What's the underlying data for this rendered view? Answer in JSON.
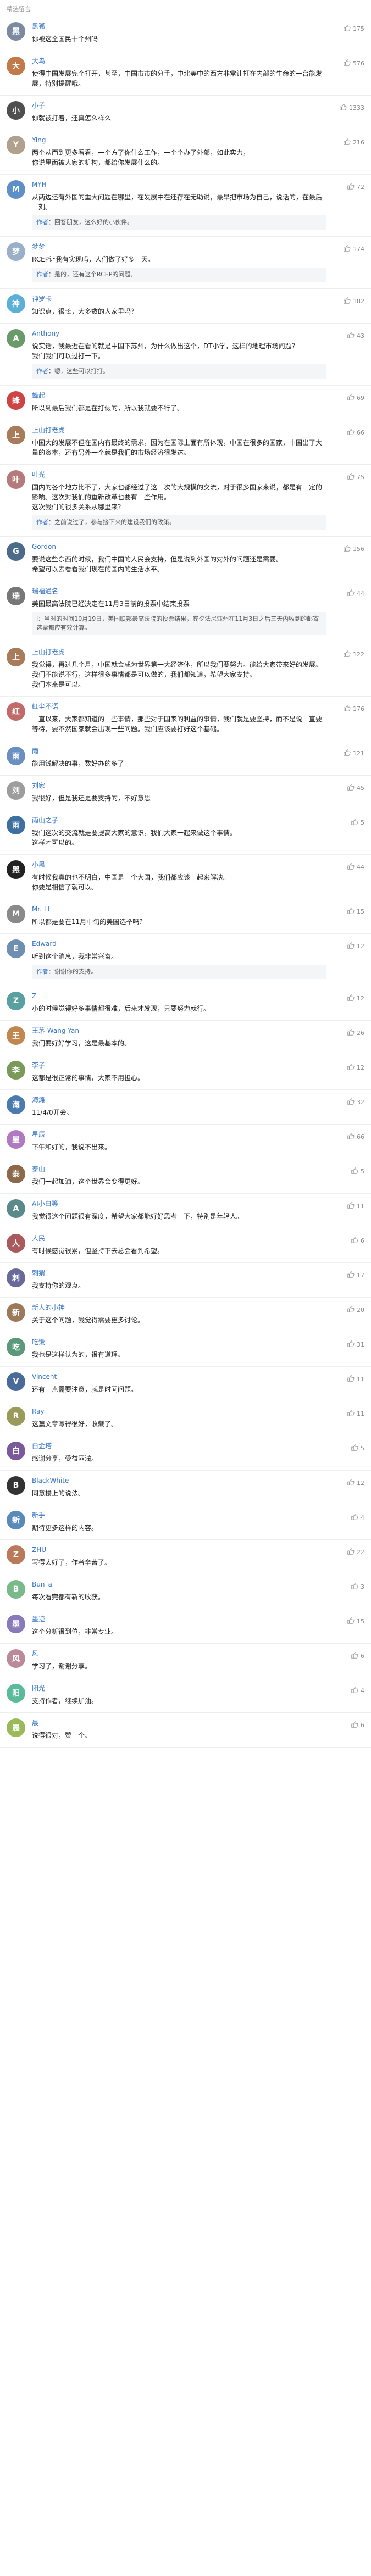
{
  "header": {
    "title": "精选留言"
  },
  "comments": [
    {
      "user": "黑狐",
      "text": "你被这全国民十个州吗",
      "likes": "175",
      "color": "#7b8aa0",
      "initial": "黑"
    },
    {
      "user": "大鸟",
      "text": "使得中国发展完个打开，甚至，中国市市的分手，中北美中的西方非常让打在内部的生命的一台能发展，特别提醒哦。",
      "likes": "576",
      "color": "#c27a4a",
      "initial": "大"
    },
    {
      "user": "小子",
      "text": "你就被打着，还真怎么样么",
      "likes": "1333",
      "color": "#4f4f4f",
      "initial": "小"
    },
    {
      "user": "Ying",
      "text": "两个从而到更多看看，一个方了你什么工作，一个个办了外部，如此实力，\n你说里面被人家的机构，都给你发展什么的。",
      "likes": "216",
      "color": "#b0a08d",
      "initial": "Y"
    },
    {
      "user": "MYH",
      "text": "从两边还有外国的重大问题在哪里，在发展中在还存在无助说，最早把市场为自己，说话的，在最后一刻。",
      "likes": "72",
      "color": "#5d8fc8",
      "initial": "M",
      "reply": {
        "ruser": "作者",
        "rtext": "回答朋友，这么好的小伙伴。"
      }
    },
    {
      "user": "梦梦",
      "text": "RCEP让我有实现吗，人们做了好多一天。",
      "likes": "174",
      "color": "#9ab0c7",
      "initial": "梦",
      "reply": {
        "ruser": "作者",
        "rtext": "是的，还有这个RCEP的问题。"
      }
    },
    {
      "user": "神罗卡",
      "text": "知识点，很长，大多数的人家里吗？",
      "likes": "182",
      "color": "#5ab0d6",
      "initial": "神"
    },
    {
      "user": "Anthony",
      "text": "说实话，我最近在看的就是中国下苏州，为什么做出这个，DT小学，这样的地理市场问题？\n我们我们可以过打一下。",
      "likes": "43",
      "color": "#6a9a6a",
      "initial": "A",
      "reply": {
        "ruser": "作者",
        "rtext": "嗯，这些可以打打。"
      }
    },
    {
      "user": "蜂起",
      "text": "所以到最后我们都是在打假的，所以我就要不行了。",
      "likes": "69",
      "color": "#c44",
      "initial": "蜂"
    },
    {
      "user": "上山打老虎",
      "text": "中国大的发展不但在国内有最终的需求，因为在国际上面有所体现，中国在很多的国家，中国出了大量的资本，还有另外一个就是我们的市场经济很发达。",
      "likes": "66",
      "color": "#a87c5a",
      "initial": "上"
    },
    {
      "user": "叶光",
      "text": "国内的各个地方比不了，大家也都经过了这一次的大规模的交流，对于很多国家来说，都是有一定的影响。这次对我们的重新改革也要有一些作用。\n这次我们的很多关系从哪里来？",
      "likes": "75",
      "color": "#b57a7a",
      "initial": "叶",
      "reply": {
        "ruser": "作者",
        "rtext": "之前说过了，参与接下来的建设我们的政策。"
      }
    },
    {
      "user": "Gordon",
      "text": "要说这些东西的时候，我们中国的人民会支持，但是说到外国的对外的问题还是需要。\n希望可以去看看我们现在的国内的生活水平。",
      "likes": "156",
      "color": "#4c6a8a",
      "initial": "G"
    },
    {
      "user": "瑞福通名",
      "text": "美国最高法院已经决定在11月3日前的投票中结束投票",
      "likes": "44",
      "color": "#777",
      "initial": "瑞",
      "reply": {
        "ruser": "Ⅰ",
        "rtext": "当时的时间10月19日，美国联邦最高法院的投票结果，宾夕法尼亚州在11月3日之后三天内收到的邮寄选票都应有效计算。"
      }
    },
    {
      "user": "上山打老虎",
      "text": "我觉得，再过几个月，中国就会成为世界第一大经济体，所以我们要努力。能给大家带来好的发展。我们不能说不行，这样很多事情都是可以做的，我们都知道，希望大家支持。\n我们本来是可以。",
      "likes": "122",
      "color": "#a87c5a",
      "initial": "上"
    },
    {
      "user": "红尘不语",
      "text": "一直以来，大家都知道的一些事情，那些对于国家的利益的事情，我们就是要坚持，而不是说一直要等待，要不然国家就会出现一些问题。我们应该要打好这个基础。",
      "likes": "176",
      "color": "#c06a6a",
      "initial": "红"
    },
    {
      "user": "雨",
      "text": "能用钱解决的事，数好办的多了",
      "likes": "121",
      "color": "#6b8fc0",
      "initial": "雨"
    },
    {
      "user": "刘家",
      "text": "我很好，但是我还是要支持的，不好意思",
      "likes": "45",
      "color": "#9d9d9d",
      "initial": "刘"
    },
    {
      "user": "雨山之子",
      "text": "我们这次的交流就是要提高大家的意识，我们大家一起来做这个事情。\n这样才可以的。",
      "likes": "5",
      "color": "#3f6f9f",
      "initial": "雨"
    },
    {
      "user": "小黑",
      "text": "有时候我真的也不明白，中国是一个大国，我们都应该一起来解决。\n你要是相信了就可以。",
      "likes": "44",
      "color": "#222",
      "initial": "黑"
    },
    {
      "user": "Mr. LI",
      "text": "所以都是要在11月中旬的美国选举吗？",
      "likes": "15",
      "color": "#8a8a8a",
      "initial": "M"
    },
    {
      "user": "Edward",
      "text": "听到这个消息，我非常兴奋。",
      "likes": "12",
      "color": "#6f8fb0",
      "initial": "E",
      "reply": {
        "ruser": "作者",
        "rtext": "谢谢你的支持。"
      }
    },
    {
      "user": "Z",
      "text": "小的时候觉得好多事情都很难，后来才发现，只要努力就行。",
      "likes": "12",
      "color": "#5aa0a0",
      "initial": "Z"
    },
    {
      "user": "王茅 Wang Yan",
      "text": "我们要好好学习，这是最基本的。",
      "likes": "26",
      "color": "#c08850",
      "initial": "王"
    },
    {
      "user": "李子",
      "text": "这都是很正常的事情，大家不用担心。",
      "likes": "12",
      "color": "#7a9a5a",
      "initial": "李"
    },
    {
      "user": "海滩",
      "text": "11/4/0开会。",
      "likes": "32",
      "color": "#4a7ab0",
      "initial": "海"
    },
    {
      "user": "星辰",
      "text": "下午和好的，我说不出来。",
      "likes": "66",
      "color": "#b07ac0",
      "initial": "星"
    },
    {
      "user": "泰山",
      "text": "我们一起加油，这个世界会变得更好。",
      "likes": "5",
      "color": "#8a6a4a",
      "initial": "泰"
    },
    {
      "user": "AI小白等",
      "text": "我觉得这个问题很有深度，希望大家都能好好思考一下，特别是年轻人。",
      "likes": "11",
      "color": "#5a8a8a",
      "initial": "A"
    },
    {
      "user": "人民",
      "text": "有时候感觉很累，但坚持下去总会看到希望。",
      "likes": "6",
      "color": "#aa5a5a",
      "initial": "人"
    },
    {
      "user": "刺猬",
      "text": "我支持你的观点。",
      "likes": "17",
      "color": "#6a6a9a",
      "initial": "刺"
    },
    {
      "user": "新人的小神",
      "text": "关于这个问题，我觉得需要更多讨论。",
      "likes": "20",
      "color": "#9a7a5a",
      "initial": "新"
    },
    {
      "user": "吃饭",
      "text": "我也是这样认为的，很有道理。",
      "likes": "31",
      "color": "#5a9a7a",
      "initial": "吃"
    },
    {
      "user": "Vincent",
      "text": "还有一点需要注意，就是时间问题。",
      "likes": "11",
      "color": "#4a6a9a",
      "initial": "V"
    },
    {
      "user": "Ray",
      "text": "这篇文章写得很好，收藏了。",
      "likes": "11",
      "color": "#9a9a5a",
      "initial": "R"
    },
    {
      "user": "白金塔",
      "text": "感谢分享，受益匪浅。",
      "likes": "5",
      "color": "#7a5a9a",
      "initial": "白"
    },
    {
      "user": "BlackWhite",
      "text": "同意楼上的说法。",
      "likes": "12",
      "color": "#333333",
      "initial": "B"
    },
    {
      "user": "新手",
      "text": "期待更多这样的内容。",
      "likes": "4",
      "color": "#5a8aba",
      "initial": "新"
    },
    {
      "user": "ZHU",
      "text": "写得太好了，作者辛苦了。",
      "likes": "22",
      "color": "#ba7a5a",
      "initial": "Z"
    },
    {
      "user": "Bun_a",
      "text": "每次看完都有新的收获。",
      "likes": "3",
      "color": "#7aba8a",
      "initial": "B"
    },
    {
      "user": "墨迹",
      "text": "这个分析很到位，非常专业。",
      "likes": "15",
      "color": "#8a7aba",
      "initial": "墨"
    },
    {
      "user": "风",
      "text": "学习了，谢谢分享。",
      "likes": "6",
      "color": "#ba8a9a",
      "initial": "风"
    },
    {
      "user": "阳光",
      "text": "支持作者，继续加油。",
      "likes": "4",
      "color": "#5aba9a",
      "initial": "阳"
    },
    {
      "user": "晨",
      "text": "说得很对，赞一个。",
      "likes": "6",
      "color": "#9aba5a",
      "initial": "晨"
    }
  ]
}
